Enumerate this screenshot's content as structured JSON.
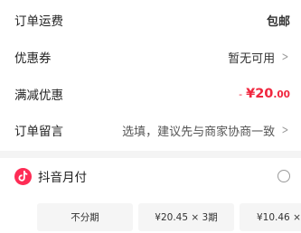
{
  "rows": {
    "shipping": {
      "label": "订单运费",
      "value": "包邮"
    },
    "coupon": {
      "label": "优惠券",
      "value": "暂无可用"
    },
    "discount": {
      "label": "满减优惠",
      "minus": "-",
      "amount": "¥20",
      "decimals": ".00"
    },
    "remark": {
      "label": "订单留言",
      "value": "选填，建议先与商家协商一致"
    }
  },
  "payment": {
    "label": "抖音月付",
    "icon": "douyin-logo-icon",
    "brand_color": "#fe2c55",
    "selected": false
  },
  "installments": [
    {
      "label": "不分期"
    },
    {
      "label": "¥20.45 × 3期"
    },
    {
      "label": "¥10.46 ×"
    }
  ],
  "colors": {
    "discount": "#f0273f",
    "divider": "#f4f4f4",
    "chip_bg": "#f5f5f5"
  },
  "icons": {
    "chevron": "chevron-right-icon",
    "radio": "radio-unchecked-icon"
  }
}
